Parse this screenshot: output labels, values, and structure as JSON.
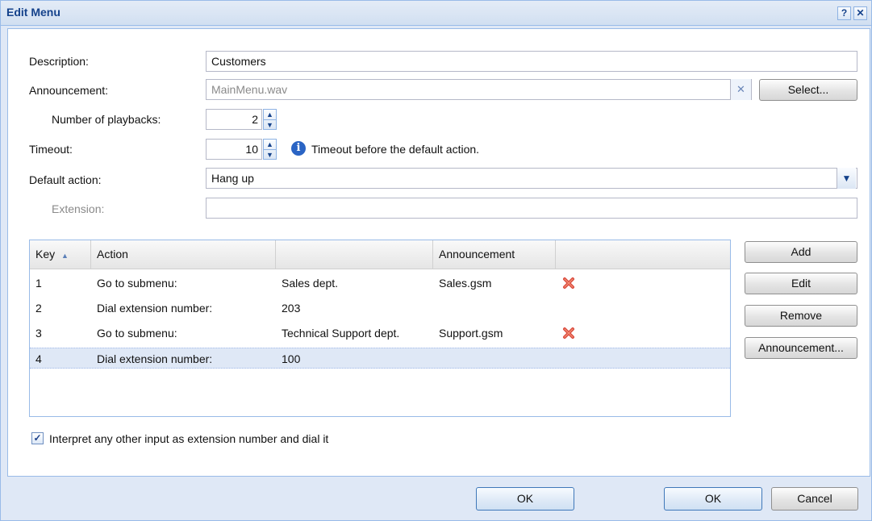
{
  "window": {
    "title": "Edit Menu",
    "help_glyph": "?",
    "close_glyph": "✕"
  },
  "form": {
    "description_label": "Description:",
    "description_value": "Customers",
    "announcement_label": "Announcement:",
    "announcement_value": "MainMenu.wav",
    "select_button": "Select...",
    "playbacks_label": "Number of playbacks:",
    "playbacks_value": "2",
    "timeout_label": "Timeout:",
    "timeout_value": "10",
    "timeout_hint": "Timeout before the default action.",
    "default_action_label": "Default action:",
    "default_action_value": "Hang up",
    "extension_label": "Extension:",
    "extension_value": ""
  },
  "grid": {
    "headers": {
      "key": "Key",
      "action": "Action",
      "target": "",
      "announcement": "Announcement"
    },
    "sort_glyph": "▲",
    "rows": [
      {
        "key": "1",
        "action": "Go to submenu:",
        "target": "Sales dept.",
        "announcement": "Sales.gsm",
        "has_remove": true
      },
      {
        "key": "2",
        "action": "Dial extension number:",
        "target": "203",
        "announcement": "",
        "has_remove": false
      },
      {
        "key": "3",
        "action": "Go to submenu:",
        "target": "Technical Support dept.",
        "announcement": "Support.gsm",
        "has_remove": true
      },
      {
        "key": "4",
        "action": "Dial extension number:",
        "target": "100",
        "announcement": "",
        "has_remove": false
      }
    ]
  },
  "side_buttons": {
    "add": "Add",
    "edit": "Edit",
    "remove": "Remove",
    "announcement": "Announcement..."
  },
  "checkbox": {
    "label": "Interpret any other input as extension number and dial it",
    "checked": true
  },
  "footer": {
    "ok_1": "OK",
    "ok_2": "OK",
    "cancel": "Cancel"
  },
  "colors": {
    "accent": "#15428b",
    "panel": "#dfe8f6",
    "border": "#99bbe8",
    "selected_row": "#dfe8f6",
    "remove_icon": "#d9473a"
  }
}
